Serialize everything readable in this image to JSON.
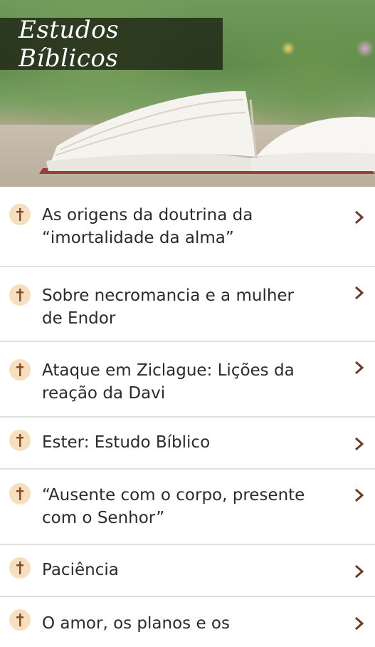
{
  "header": {
    "title": "Estudos Bíblicos"
  },
  "icons": {
    "item_badge": "cross-icon",
    "item_arrow": "chevron-right-icon"
  },
  "colors": {
    "badge_bg": "#f5dfbf",
    "cross": "#8a4b2a",
    "chevron": "#6b3a2a",
    "text": "#2b2b2b",
    "divider": "#e0e0e0"
  },
  "studies": {
    "items": [
      {
        "line1": "As origens da doutrina da",
        "line2": "“imortalidade da alma”"
      },
      {
        "line1": "Sobre necromancia e a mulher",
        "line2": "de Endor"
      },
      {
        "line1": "Ataque em Ziclague: Lições da",
        "line2": "reação da Davi"
      },
      {
        "line1": "Ester: Estudo Bíblico",
        "line2": ""
      },
      {
        "line1": "“Ausente com o corpo, presente",
        "line2": "com o Senhor”"
      },
      {
        "line1": "Paciência",
        "line2": ""
      },
      {
        "line1": "O amor, os planos e os",
        "line2": ""
      }
    ]
  }
}
